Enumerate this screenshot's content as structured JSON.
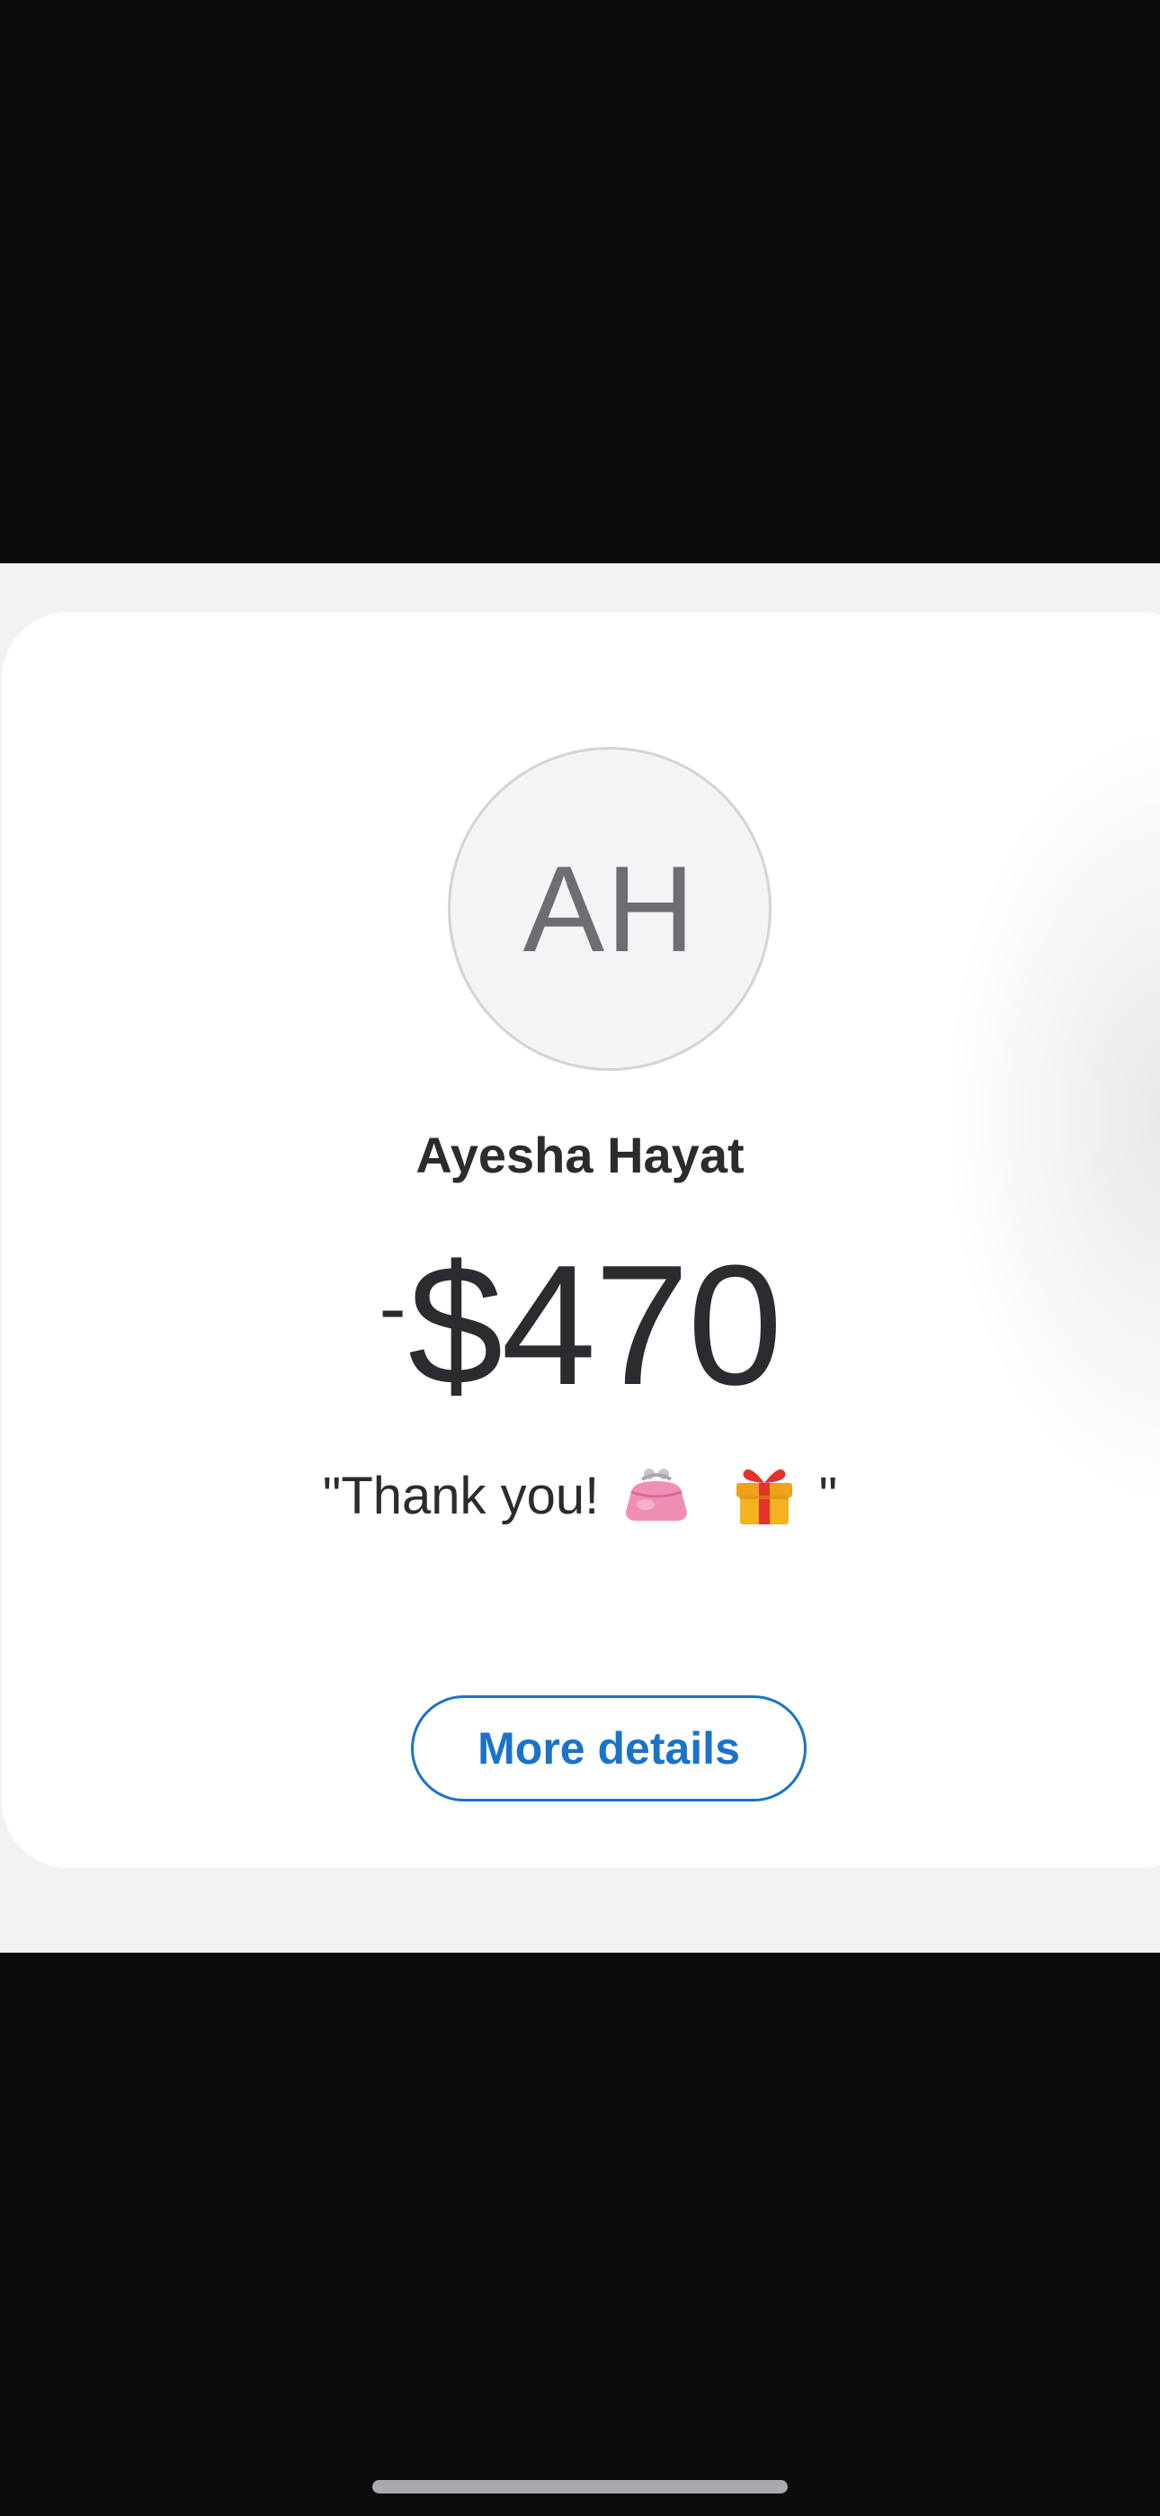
{
  "recipient": {
    "initials": "AH",
    "name": "Ayesha Hayat"
  },
  "transaction": {
    "sign": "-",
    "amount": "$470",
    "note_prefix": "\"Thank you!",
    "note_suffix": "\"",
    "note_icons": [
      "purse-emoji",
      "gift-emoji"
    ]
  },
  "actions": {
    "more_details_label": "More details"
  },
  "colors": {
    "accent": "#1a73c7",
    "text": "#2b2b30",
    "avatar_text": "#6d6d73",
    "sheet_background": "#f2f2f3",
    "card_background": "#ffffff",
    "letterbox": "#0b0b0c"
  }
}
